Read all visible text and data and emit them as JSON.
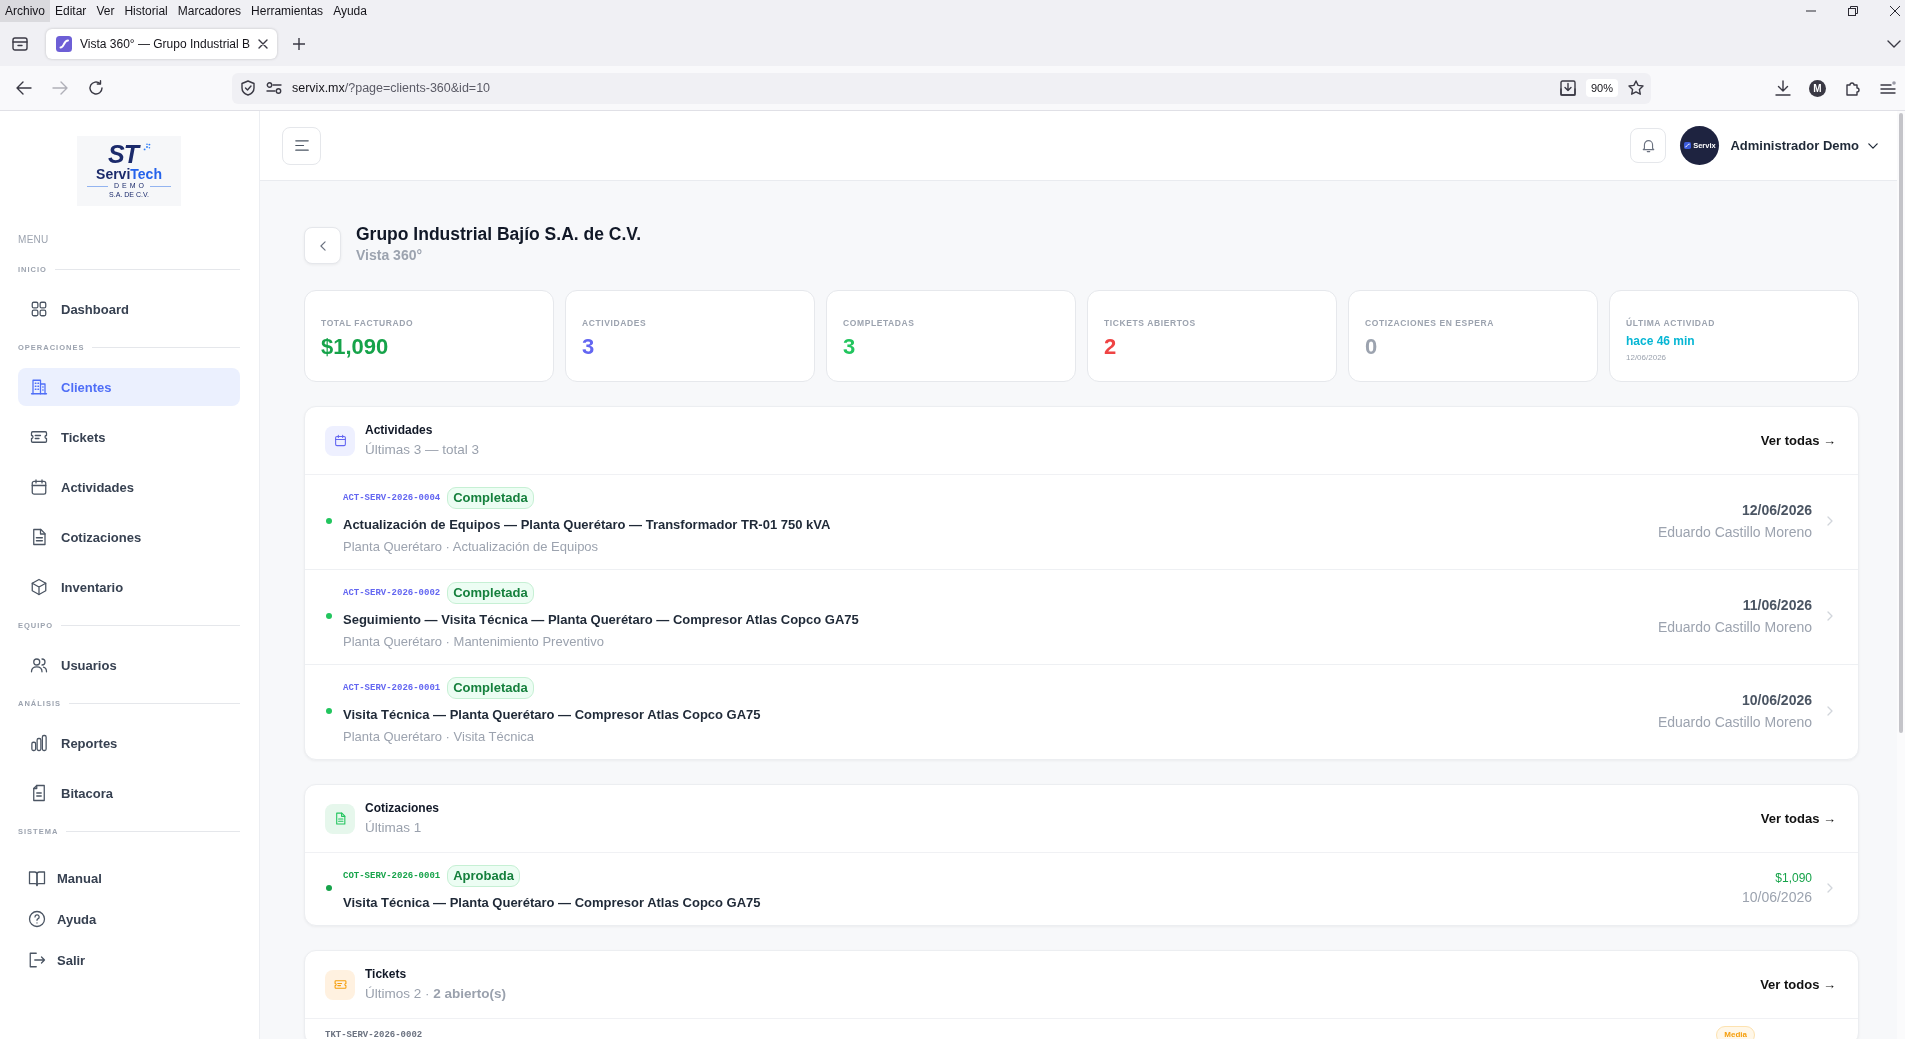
{
  "browser": {
    "menu": [
      {
        "label": "Archivo",
        "selected": true
      },
      {
        "label": "Editar",
        "selected": false
      },
      {
        "label": "Ver",
        "selected": false
      },
      {
        "label": "Historial",
        "selected": false
      },
      {
        "label": "Marcadores",
        "selected": false
      },
      {
        "label": "Herramientas",
        "selected": false
      },
      {
        "label": "Ayuda",
        "selected": false
      }
    ],
    "tab_title": "Vista 360° — Grupo Industrial B",
    "url_host": "servix.mx",
    "url_path": "/?page=clients-360&id=10",
    "zoom": "90%",
    "account_initial": "M"
  },
  "sidebar": {
    "logo": {
      "monogram": "ST",
      "wordmark_main": "Servi",
      "wordmark_accent": "Tech",
      "tagline": "DEMO",
      "legal_name": "S.A. DE C.V."
    },
    "menu_label": "MENU",
    "sections": [
      {
        "label": "INICIO",
        "kind": "main",
        "items": [
          {
            "label": "Dashboard",
            "selected": false
          }
        ]
      },
      {
        "label": "OPERACIONES",
        "kind": "main",
        "items": [
          {
            "label": "Clientes",
            "selected": true
          },
          {
            "label": "Tickets",
            "selected": false
          },
          {
            "label": "Actividades",
            "selected": false
          },
          {
            "label": "Cotizaciones",
            "selected": false
          },
          {
            "label": "Inventario",
            "selected": false
          }
        ]
      },
      {
        "label": "EQUIPO",
        "kind": "main",
        "items": [
          {
            "label": "Usuarios",
            "selected": false
          }
        ]
      },
      {
        "label": "ANÁLISIS",
        "kind": "main",
        "items": [
          {
            "label": "Reportes",
            "selected": false
          },
          {
            "label": "Bitacora",
            "selected": false
          }
        ]
      },
      {
        "label": "SISTEMA",
        "kind": "system",
        "items": [
          {
            "label": "Manual",
            "selected": false
          },
          {
            "label": "Ayuda",
            "selected": false
          },
          {
            "label": "Salir",
            "selected": false
          }
        ]
      }
    ]
  },
  "topbar": {
    "avatar_logo": "Servix",
    "user_name": "Administrador Demo"
  },
  "page": {
    "title": "Grupo Industrial Bajío S.A. de C.V.",
    "subtitle": "Vista 360°"
  },
  "stats": [
    {
      "label": "TOTAL FACTURADO",
      "value": "$1,090",
      "kind": "number",
      "color": "#16a34a"
    },
    {
      "label": "ACTIVIDADES",
      "value": "3",
      "kind": "number",
      "color": "#6366f1"
    },
    {
      "label": "COMPLETADAS",
      "value": "3",
      "kind": "number",
      "color": "#22c55e"
    },
    {
      "label": "TICKETS ABIERTOS",
      "value": "2",
      "kind": "number",
      "color": "#ef4444"
    },
    {
      "label": "COTIZACIONES EN ESPERA",
      "value": "0",
      "kind": "number",
      "color": "#9ca3af"
    },
    {
      "label": "ÚLTIMA ACTIVIDAD",
      "value": "hace 46 min",
      "note": "12/06/2026",
      "kind": "recent",
      "color": "#06b6d4"
    }
  ],
  "panels": [
    {
      "kind": "activities",
      "title": "Actividades",
      "subtitle": "Últimas 3 — total 3",
      "link": "Ver todas →",
      "rows": [
        {
          "code": "ACT-SERV-2026-0004",
          "status": "Completada",
          "title": "Actualización de Equipos — Planta Querétaro — Transformador TR-01 750 kVA",
          "meta": "Planta Querétaro · Actualización de Equipos",
          "date": "12/06/2026",
          "person": "Eduardo Castillo Moreno"
        },
        {
          "code": "ACT-SERV-2026-0002",
          "status": "Completada",
          "title": "Seguimiento — Visita Técnica — Planta Querétaro — Compresor Atlas Copco GA75",
          "meta": "Planta Querétaro · Mantenimiento Preventivo",
          "date": "11/06/2026",
          "person": "Eduardo Castillo Moreno"
        },
        {
          "code": "ACT-SERV-2026-0001",
          "status": "Completada",
          "title": "Visita Técnica — Planta Querétaro — Compresor Atlas Copco GA75",
          "meta": "Planta Querétaro · Visita Técnica",
          "date": "10/06/2026",
          "person": "Eduardo Castillo Moreno"
        }
      ]
    },
    {
      "kind": "quotes",
      "title": "Cotizaciones",
      "subtitle": "Últimas 1",
      "link": "Ver todas →",
      "rows": [
        {
          "code": "COT-SERV-2026-0001",
          "status": "Aprobada",
          "title": "Visita Técnica — Planta Querétaro — Compresor Atlas Copco GA75",
          "amount": "$1,090",
          "date": "10/06/2026"
        }
      ]
    },
    {
      "kind": "tickets",
      "title": "Tickets",
      "subtitle": "Últimos 2 · **2 abierto(s)**",
      "link": "Ver todos →",
      "rows": [
        {
          "code": "TKT-SERV-2026-0002",
          "priority": "Media"
        }
      ]
    }
  ]
}
